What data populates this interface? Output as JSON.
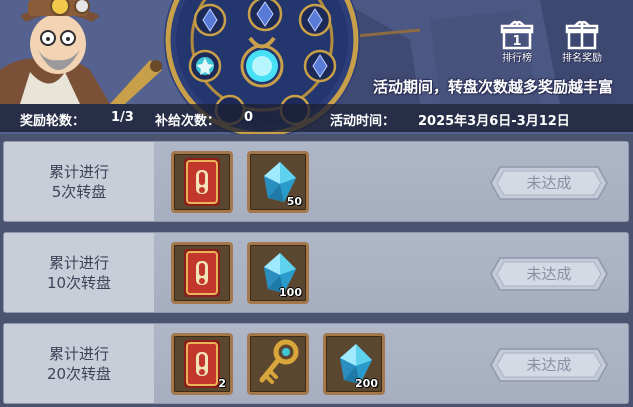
{
  "banner": {
    "tagline": "活动期间，转盘次数越多奖励越丰富",
    "buttons": {
      "ranking": "排行榜",
      "ranking_reward": "排名奖励"
    },
    "ranking_rank_digit": "1"
  },
  "info": {
    "reward_rounds_label": "奖励轮数：",
    "reward_rounds_value": "1/3",
    "refill_label": "补给次数：",
    "refill_value": "0",
    "time_label": "活动时间：",
    "time_value": "2025年3月6日-3月12日"
  },
  "rows": [
    {
      "line1": "累计进行",
      "line2": "5次转盘",
      "items": [
        {
          "icon": "red-card-icon",
          "count": ""
        },
        {
          "icon": "blue-crystal-icon",
          "count": "50"
        }
      ],
      "status": "未达成"
    },
    {
      "line1": "累计进行",
      "line2": "10次转盘",
      "items": [
        {
          "icon": "red-card-icon",
          "count": ""
        },
        {
          "icon": "blue-crystal-icon",
          "count": "100"
        }
      ],
      "status": "未达成"
    },
    {
      "line1": "累计进行",
      "line2": "20次转盘",
      "items": [
        {
          "icon": "red-card-icon",
          "count": "2"
        },
        {
          "icon": "gold-key-icon",
          "count": ""
        },
        {
          "icon": "blue-crystal-icon",
          "count": "200"
        }
      ],
      "status": "未达成"
    }
  ],
  "colors": {
    "item_border": "#a4784a",
    "card_red": "#b8322a",
    "crystal_blue": "#5fd2f0",
    "status_text": "#8990a4"
  }
}
